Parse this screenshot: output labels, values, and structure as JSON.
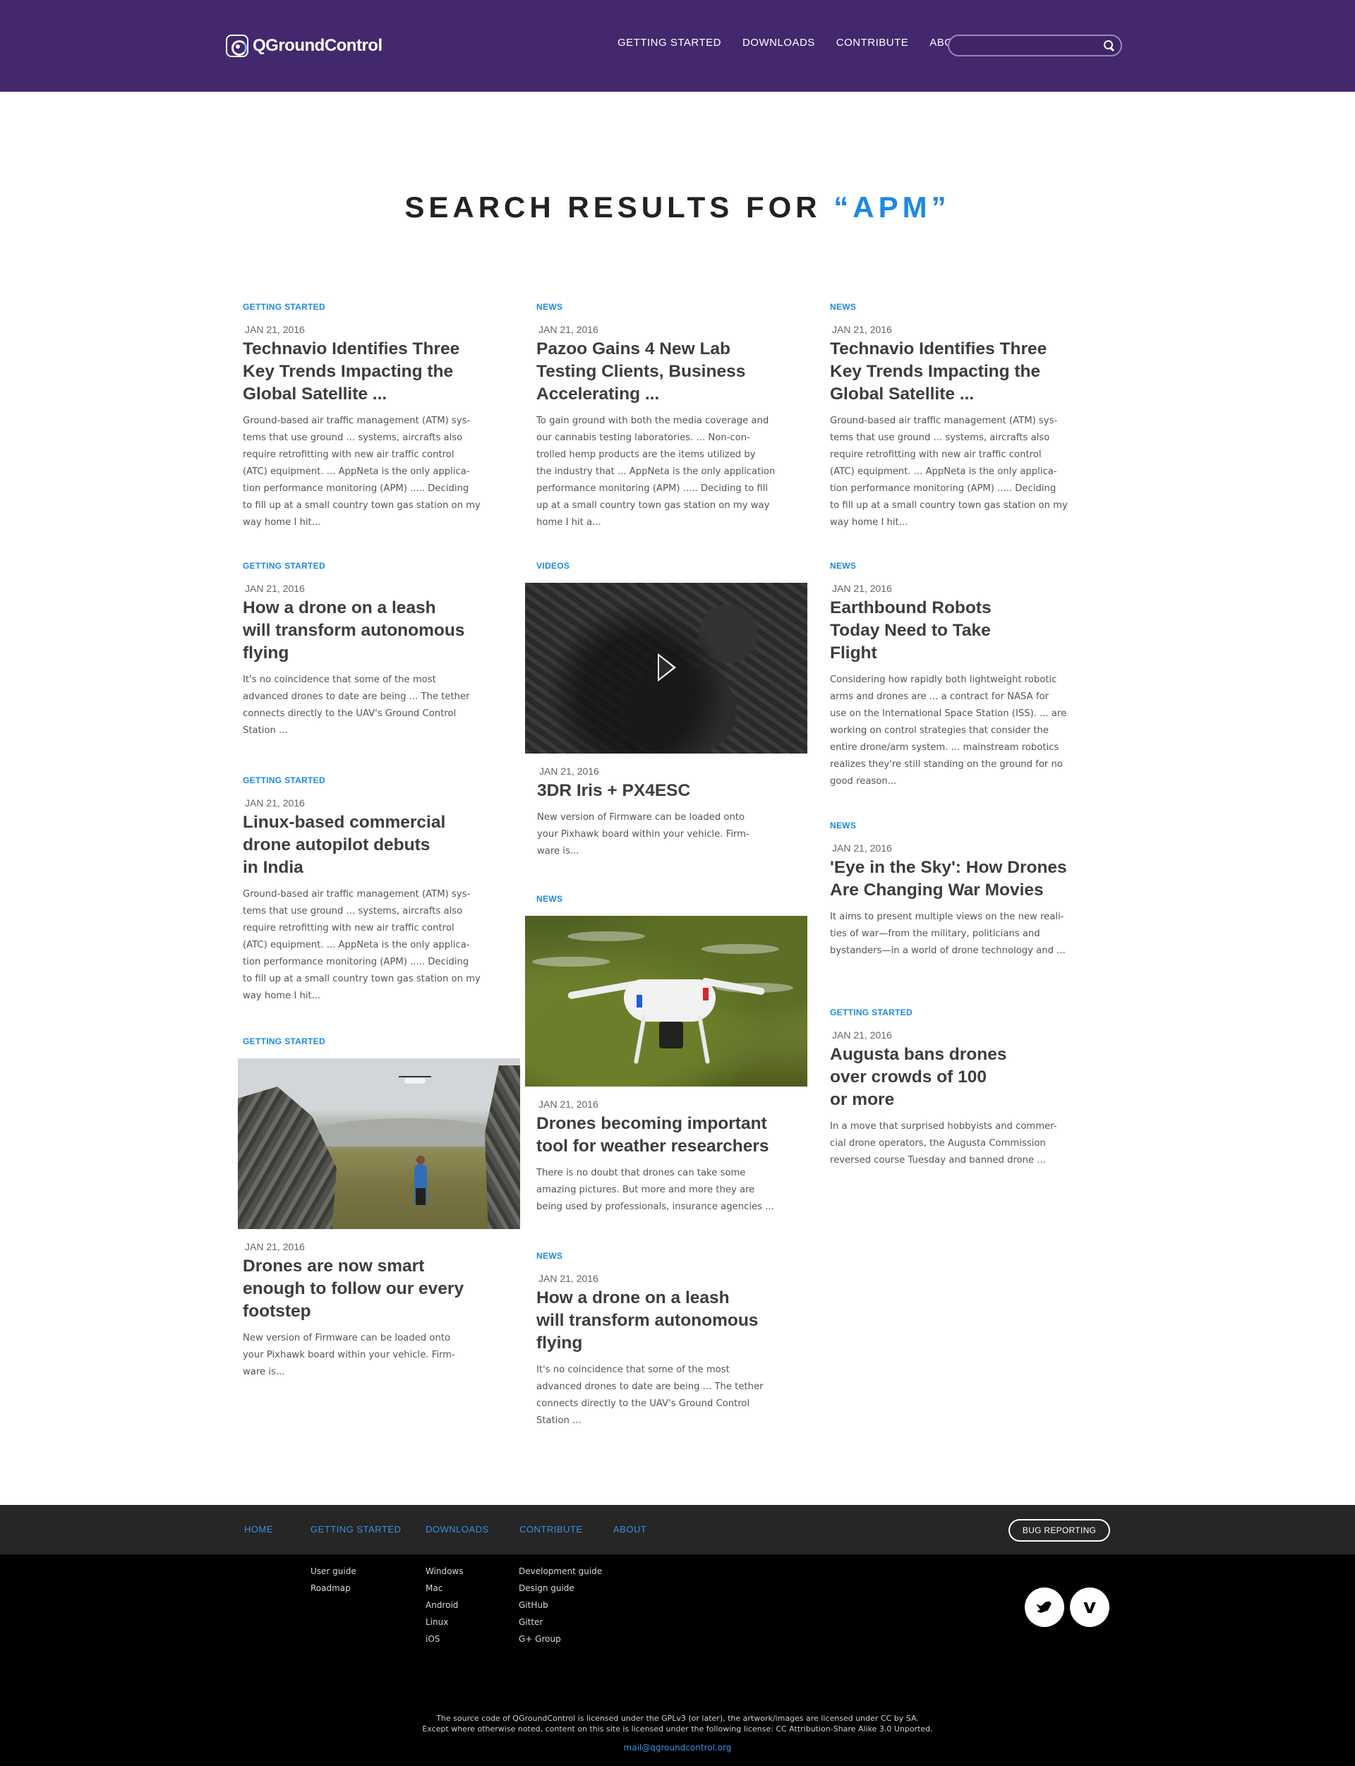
{
  "header": {
    "logo_text": "QGroundControl",
    "nav": [
      "GETTING STARTED",
      "DOWNLOADS",
      "CONTRIBUTE",
      "ABOUT"
    ],
    "search_value": ""
  },
  "page": {
    "title_prefix": "SEARCH RESULTS FOR ",
    "title_query": "“APM”"
  },
  "results": {
    "col1": [
      {
        "category": "GETTING STARTED",
        "date": "JAN 21, 2016",
        "title_lines": [
          "Technavio Identifies Three",
          "Key Trends Impacting the",
          "Global Satellite ..."
        ],
        "excerpt_lines": [
          "Ground-based air traffic management (ATM) sys-",
          "tems that use ground ... systems, aircrafts also",
          "require retrofitting with new air traffic control",
          "(ATC) equipment. ... AppNeta is the only applica-",
          "tion performance monitoring (APM) ..... Deciding",
          "to fill up at a small country town gas station on my",
          "way home I hit..."
        ]
      },
      {
        "category": "GETTING STARTED",
        "date": "JAN 21, 2016",
        "title_lines": [
          "How a drone on a leash",
          "will transform autonomous",
          "flying"
        ],
        "excerpt_lines": [
          "It's no coincidence that some of the most",
          "advanced drones to date are being ... The tether",
          "connects directly to the UAV's Ground Control",
          "Station ..."
        ]
      },
      {
        "category": "GETTING STARTED",
        "date": "JAN 21, 2016",
        "title_lines": [
          "Linux-based commercial",
          "drone autopilot debuts",
          "in India"
        ],
        "excerpt_lines": [
          "Ground-based air traffic management (ATM) sys-",
          "tems that use ground ... systems, aircrafts also",
          "require retrofitting with new air traffic control",
          "(ATC) equipment. ... AppNeta is the only applica-",
          "tion performance monitoring (APM) ..... Deciding",
          "to fill up at a small country town gas station on my",
          "way home I hit..."
        ]
      },
      {
        "category": "GETTING STARTED",
        "date": "JAN 21, 2016",
        "image": "runner-landscape-photo",
        "title_lines": [
          "Drones are now smart",
          "enough to follow our every",
          "footstep"
        ],
        "excerpt_lines": [
          "New version of Firmware can be loaded onto",
          "your Pixhawk board within your vehicle. Firm-",
          "ware is..."
        ]
      }
    ],
    "col2": [
      {
        "category": "NEWS",
        "date": "JAN 21, 2016",
        "title_lines": [
          "Pazoo Gains 4 New Lab",
          "Testing Clients, Business",
          "Accelerating ..."
        ],
        "excerpt_lines": [
          "To gain ground with both the media coverage and",
          "our cannabis testing laboratories. ... Non-con-",
          "trolled hemp products are the items utilized by",
          "the industry that ... AppNeta is the only application",
          "performance monitoring (APM) ..... Deciding to fill",
          "up at a small country town gas station on my way",
          "home I hit a..."
        ]
      },
      {
        "category": "VIDEOS",
        "date": "JAN 21, 2016",
        "image": "aerial-harbor-video",
        "title_lines": [
          "3DR Iris + PX4ESC"
        ],
        "excerpt_lines": [
          "New version of Firmware can be loaded onto",
          "your Pixhawk board within your vehicle. Firm-",
          "ware is..."
        ]
      },
      {
        "category": "NEWS",
        "date": "JAN 21, 2016",
        "image": "white-drone-photo",
        "title_lines": [
          "Drones becoming important",
          "tool for weather researchers"
        ],
        "excerpt_lines": [
          "There is no doubt that drones can take some",
          "amazing pictures. But more and more they are",
          "being used by professionals, insurance agencies ..."
        ]
      },
      {
        "category": "NEWS",
        "date": "JAN 21, 2016",
        "title_lines": [
          "How a drone on a leash",
          "will transform autonomous",
          "flying"
        ],
        "excerpt_lines": [
          "It's no coincidence that some of the most",
          "advanced drones to date are being ... The tether",
          "connects directly to the UAV's Ground Control",
          "Station ..."
        ]
      }
    ],
    "col3": [
      {
        "category": "NEWS",
        "date": "JAN 21, 2016",
        "title_lines": [
          "Technavio Identifies Three",
          "Key Trends Impacting the",
          "Global Satellite ..."
        ],
        "excerpt_lines": [
          "Ground-based air traffic management (ATM) sys-",
          "tems that use ground ... systems, aircrafts also",
          "require retrofitting with new air traffic control",
          "(ATC) equipment. ... AppNeta is the only applica-",
          "tion performance monitoring (APM) ..... Deciding",
          "to fill up at a small country town gas station on my",
          "way home I hit..."
        ]
      },
      {
        "category": "NEWS",
        "date": "JAN 21, 2016",
        "title_lines": [
          "Earthbound Robots",
          "Today Need to Take",
          "Flight"
        ],
        "excerpt_lines": [
          "Considering how rapidly both lightweight robotic",
          "arms and drones are ... a contract for NASA for",
          "use on the International Space Station (ISS). ... are",
          "working on control strategies that consider the",
          "entire drone/arm system. ... mainstream robotics",
          "realizes they're still standing on the ground for no",
          "good reason..."
        ]
      },
      {
        "category": "NEWS",
        "date": "JAN 21, 2016",
        "title_lines": [
          "'Eye in the Sky': How Drones",
          "Are Changing War Movies"
        ],
        "excerpt_lines": [
          "It aims to present multiple views on the new reali-",
          "ties of war—from the military, politicians and",
          "bystanders—in a world of drone technology and ..."
        ]
      },
      {
        "category": "GETTING STARTED",
        "date": "JAN 21, 2016",
        "title_lines": [
          "Augusta bans drones",
          "over crowds of 100",
          "or more"
        ],
        "excerpt_lines": [
          "In a move that surprised hobbyists and commer-",
          "cial drone operators, the Augusta Commission",
          "reversed course Tuesday and banned drone ..."
        ]
      }
    ]
  },
  "footer": {
    "nav": [
      "HOME",
      "GETTING STARTED",
      "DOWNLOADS",
      "CONTRIBUTE",
      "ABOUT"
    ],
    "bug_button": "BUG REPORTING",
    "getting_started_links": [
      "User guide",
      "Roadmap"
    ],
    "download_links": [
      "Windows",
      "Mac",
      "Android",
      "Linux",
      "iOS"
    ],
    "contribute_links": [
      "Development guide",
      "Design guide",
      "GitHub",
      "Gitter",
      "G+ Group"
    ],
    "social_icons": [
      "twitter-icon",
      "vimeo-icon"
    ],
    "license_line1": "The source code of QGroundControl is licensed under the GPLv3 (or later), the artwork/images are licensed under CC by SA.",
    "license_line2": "Except where otherwise noted, content on this site is licensed under the following license: CC Attribution-Share Alike 3.0 Unported.",
    "email": "mail@qgroundcontrol.org"
  },
  "colors": {
    "header_bg": "#44286e",
    "accent": "#1e88e5",
    "footer_top": "#262626",
    "footer_bottom": "#000000"
  }
}
